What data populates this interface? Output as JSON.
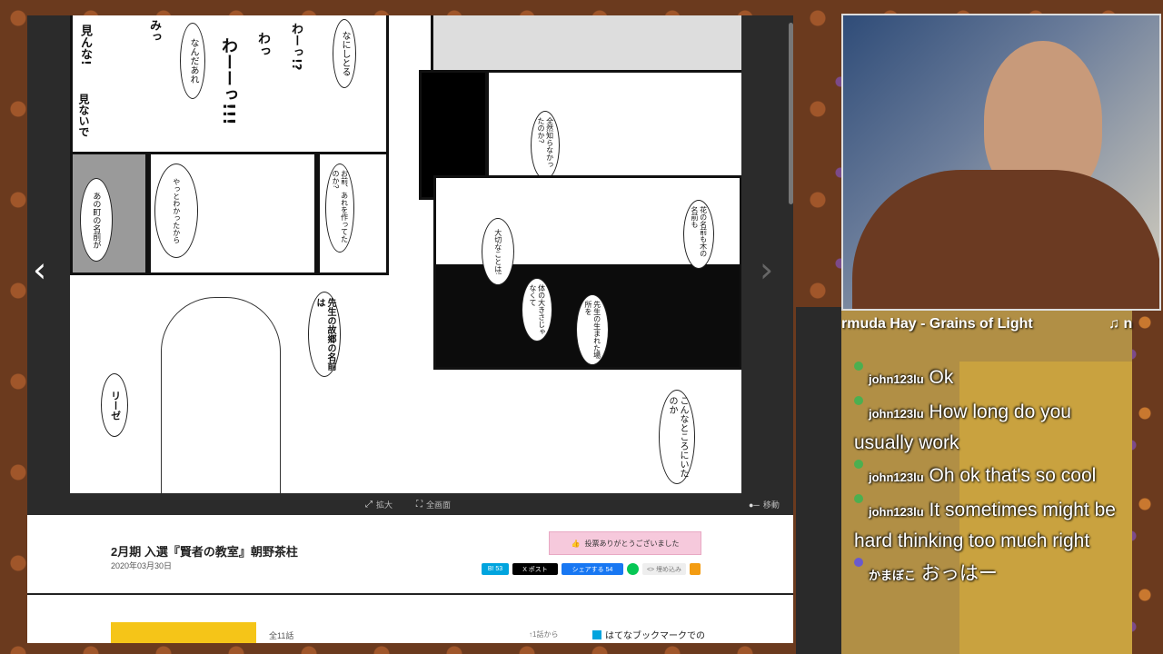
{
  "viewer": {
    "prev_label": "‹",
    "next_label": "›",
    "zoom_label": "拡大",
    "fullscreen_label": "全画面",
    "move_label": "移動"
  },
  "manga": {
    "sfx": [
      "みっ",
      "わっ",
      "わーっ!?",
      "わーーっ!!!",
      "見んな!",
      "見ないで"
    ],
    "bubbles": [
      "なんだあれ",
      "なにしとる",
      "あの町の名前が",
      "やっとわかったから",
      "お前、あれを作ってたのか?",
      "先生の故郷の名前は",
      "リーゼ",
      "こんなところにいたのか",
      "花の名前も木の名前も",
      "全然知らなかったのか?",
      "大切なことは!",
      "先生の生まれた場所を",
      "体の大きさじゃなくて"
    ]
  },
  "article": {
    "title": "2月期 入選『賢者の教室』朝野茶柱",
    "date": "2020年03月30日",
    "vote_label": "投票ありがとうございました",
    "share": {
      "hatena_count": "53",
      "x_label": "X ポスト",
      "fb_label": "シェアする 54",
      "line_label": "",
      "embed_label": "<> 埋め込み"
    },
    "total_label": "全11話",
    "order_label": "↑1話から",
    "bookmark_label": "はてなブックマークでの"
  },
  "stream": {
    "music": "rmuda Hay - Grains of Light",
    "note": "♫ n",
    "chat": [
      {
        "user": "john123lu",
        "text": "Ok"
      },
      {
        "user": "john123lu",
        "text": "How long do you usually work"
      },
      {
        "user": "john123lu",
        "text": "Oh ok that's so cool"
      },
      {
        "user": "john123lu",
        "text": "It sometimes might be hard thinking too much right"
      },
      {
        "user": "かまぼこ",
        "text": "おっはー"
      }
    ]
  }
}
